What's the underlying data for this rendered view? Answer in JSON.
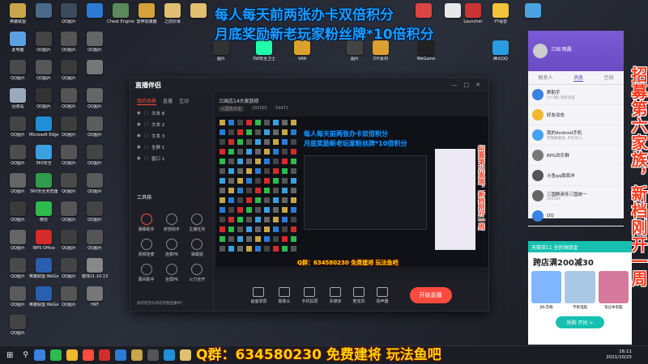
{
  "desktop": {
    "icons": [
      {
        "label": "英雄联盟",
        "color": "#c8a64a"
      },
      {
        "label": "",
        "color": "#4a6a8a"
      },
      {
        "label": "QQ图片",
        "color": "#3b4a5c"
      },
      {
        "label": "",
        "color": "#2a7bd4"
      },
      {
        "label": "Cheat Engine",
        "color": "#5a8a5a"
      },
      {
        "label": "雷神加速器",
        "color": "#d4a13a"
      },
      {
        "label": "之前抄录",
        "color": "#e0c070"
      },
      {
        "label": "",
        "color": "#e0c070"
      },
      {
        "label": "此电脑",
        "color": "#5aa0e0"
      },
      {
        "label": "QQ图片",
        "color": "#444"
      },
      {
        "label": "QQ图片",
        "color": "#555"
      },
      {
        "label": "QQ图片",
        "color": "#666"
      },
      {
        "label": "QQ图片",
        "color": "#4a4a4a"
      },
      {
        "label": "QQ图片",
        "color": "#575757"
      },
      {
        "label": "QQ图片",
        "color": "#3a3a3a"
      },
      {
        "label": "",
        "color": "#777"
      },
      {
        "label": "回收站",
        "color": "#9ab"
      },
      {
        "label": "QQ图片",
        "color": "#333"
      },
      {
        "label": "QQ图片",
        "color": "#555"
      },
      {
        "label": "QQ图片",
        "color": "#666"
      },
      {
        "label": "QQ图片",
        "color": "#444"
      },
      {
        "label": "Microsoft Edge",
        "color": "#1f8fd8"
      },
      {
        "label": "QQ图片",
        "color": "#3d3d3d"
      },
      {
        "label": "QQ图片",
        "color": "#5d5d5d"
      },
      {
        "label": "QQ图片",
        "color": "#4d4d4d"
      },
      {
        "label": "360安全",
        "color": "#3aa0e0"
      },
      {
        "label": "QQ图片",
        "color": "#555"
      },
      {
        "label": "QQ图片",
        "color": "#444"
      },
      {
        "label": "QQ图片",
        "color": "#666"
      },
      {
        "label": "360安全浏览器",
        "color": "#2e9c4a"
      },
      {
        "label": "QQ图片",
        "color": "#4a4a4a"
      },
      {
        "label": "QQ图片",
        "color": "#5a5a5a"
      },
      {
        "label": "QQ图片",
        "color": "#3a3a3a"
      },
      {
        "label": "微信",
        "color": "#2dbb4e"
      },
      {
        "label": "QQ图片",
        "color": "#555"
      },
      {
        "label": "QQ图片",
        "color": "#444"
      },
      {
        "label": "QQ图片",
        "color": "#666"
      },
      {
        "label": "WPS Office",
        "color": "#d42b2b"
      },
      {
        "label": "QQ图片",
        "color": "#3e3e3e"
      },
      {
        "label": "QQ图片",
        "color": "#555"
      },
      {
        "label": "QQ图片",
        "color": "#4a4a4a"
      },
      {
        "label": "英雄联盟 WeGame版",
        "color": "#2a5fb0"
      },
      {
        "label": "QQ图片",
        "color": "#444"
      },
      {
        "label": "装饰21.10.13",
        "color": "#888"
      },
      {
        "label": "QQ图片",
        "color": "#5a5a5a"
      },
      {
        "label": "英雄联盟 WeGame版",
        "color": "#2a5fb0"
      },
      {
        "label": "QQ图片",
        "color": "#555"
      },
      {
        "label": "HRT",
        "color": "#777"
      },
      {
        "label": "QQ图片",
        "color": "#444"
      }
    ],
    "top_icons": [
      {
        "label": "",
        "color": "#d44"
      },
      {
        "label": "",
        "color": "#e8e8e8"
      },
      {
        "label": "Launcher",
        "color": "#c33"
      },
      {
        "label": "YY语音",
        "color": "#f2c23a"
      },
      {
        "label": "",
        "color": "#4aa3e0"
      }
    ],
    "mid_icons": [
      {
        "label": "图片",
        "color": "#333"
      },
      {
        "label": "3W安全卫士",
        "color": "#2fa"
      },
      {
        "label": "VAN",
        "color": "#dca030"
      },
      {
        "label": "图片",
        "color": "#444"
      },
      {
        "label": "DIY素材",
        "color": "#dca030"
      },
      {
        "label": "WeGame",
        "color": "#222"
      },
      {
        "label": "腾讯QQ",
        "color": "#2a9de0"
      }
    ]
  },
  "overlay": {
    "line1": "每人每天前两张办卡双倍积分",
    "line2": "月底奖励新老玩家粉丝牌*10倍积分",
    "qgroup_bottom": "Q群：634580230 免费建将 玩法鱼吧",
    "qgroup_mini": "Q群：634580230 免费建将 玩法鱼吧",
    "vertical": "招募第六家族，新档刚开一周"
  },
  "app": {
    "logo": "直播伴侣",
    "tabs": [
      "我的场景",
      "直播",
      "互动"
    ],
    "sources": [
      "文本 8",
      "文本 2",
      "文本 3",
      "全屏 1",
      "窗口 1"
    ],
    "tools_title": "工具箱",
    "tools": [
      {
        "label": "弹幕助手",
        "color": "#ff4b3e"
      },
      {
        "label": "房管助手",
        "color": "#888"
      },
      {
        "label": "主播任务",
        "color": "#888"
      },
      {
        "label": "视频连麦",
        "color": "#888"
      },
      {
        "label": "连麦PK",
        "color": "#888"
      },
      {
        "label": "弹幕姬",
        "color": "#888"
      },
      {
        "label": "幕间助手",
        "color": "#888"
      },
      {
        "label": "全屏PK",
        "color": "#888"
      },
      {
        "label": "火力全开",
        "color": "#888"
      }
    ],
    "tip": "如何把音乐改成到我直播中?",
    "main_title": "三国志14大家族修",
    "info_a": "三国志大全",
    "info_b": "291581",
    "info_c": "54472",
    "bottom_buttons": [
      "画面录屏",
      "摄像头",
      "手机投屏",
      "多媒体",
      "麦克风",
      "扬声器"
    ],
    "start_label": "开始直播"
  },
  "qq": {
    "name": "三国 雨晨",
    "tabs": [
      "联系人",
      "消息",
      "空间"
    ],
    "rows": [
      {
        "name": "群助手",
        "sub": "[4个群] 有新消息",
        "color": "#3a82e0"
      },
      {
        "name": "好友动态",
        "sub": "",
        "color": "#f2b630"
      },
      {
        "name": "我的Android手机",
        "sub": "无需数据线, 手机可以...",
        "color": "#46a0f0"
      },
      {
        "name": "RPG欢乐群",
        "sub": "",
        "color": "#777"
      },
      {
        "name": "斗鱼qq周周冲",
        "sub": "",
        "color": "#555"
      },
      {
        "name": "三国群英传三国统一",
        "sub": "291581",
        "color": "#666"
      },
      {
        "name": "QQ",
        "sub": "",
        "color": "#3a82e0"
      }
    ]
  },
  "ad": {
    "header": "天猫双11 全民抽现金",
    "promo": "跨店满200减30",
    "items": [
      "JBL音箱",
      "平板电脑",
      "笔记本电脑"
    ],
    "cta": "抢购 开抢 >"
  },
  "taskbar": {
    "time": "16:11",
    "date": "2021/10/25"
  }
}
